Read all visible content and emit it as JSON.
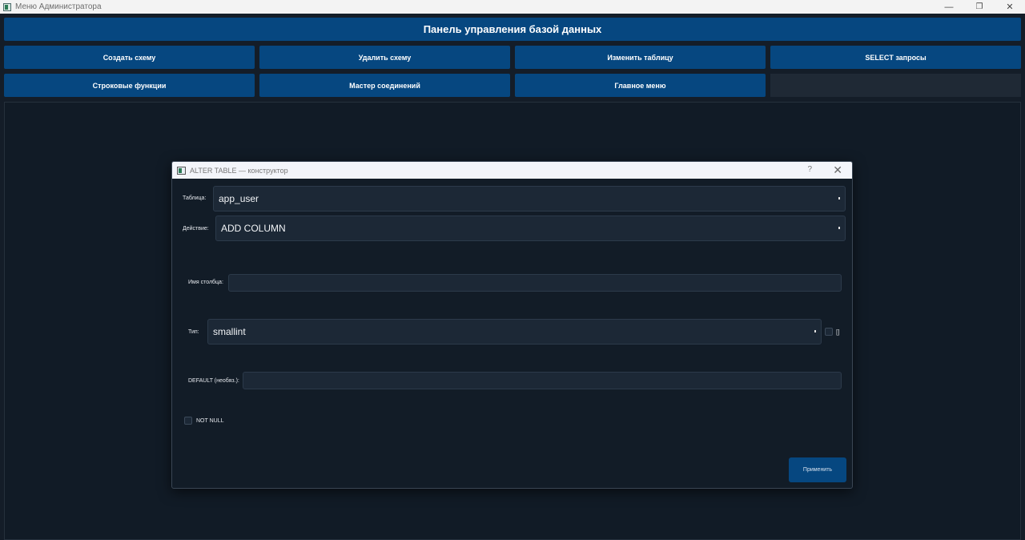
{
  "window": {
    "title": "Меню Администратора",
    "minimize_glyph": "—",
    "restore_glyph": "❐",
    "close_glyph": "✕"
  },
  "header": {
    "title": "Панель управления базой данных"
  },
  "nav": {
    "create_schema": "Создать схему",
    "delete_schema": "Удалить схему",
    "alter_table": "Изменить таблицу",
    "select_queries": "SELECT запросы",
    "string_functions": "Строковые функции",
    "join_wizard": "Мастер соединений",
    "main_menu": "Главное меню"
  },
  "dialog": {
    "title": "ALTER TABLE — конструктор",
    "help_glyph": "?",
    "close_glyph": "✕",
    "table_label": "Таблица:",
    "table_value": "app_user",
    "action_label": "Действие:",
    "action_value": "ADD COLUMN",
    "column_name_label": "Имя столбца:",
    "column_name_value": "",
    "type_label": "Тип:",
    "type_value": "smallint",
    "type_extra_glyph": "[]",
    "default_label": "DEFAULT (необяз.):",
    "default_value": "",
    "not_null_label": "NOT NULL",
    "apply_button": "Применить"
  },
  "colors": {
    "accent": "#064780",
    "background": "#141d28",
    "panel": "#111b26",
    "field": "#1c2836"
  }
}
